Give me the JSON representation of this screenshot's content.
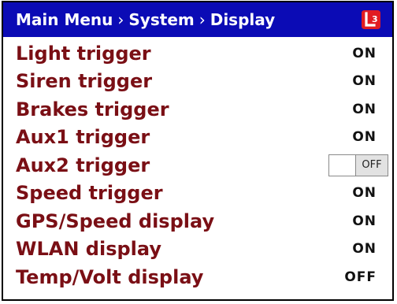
{
  "header": {
    "crumbs": [
      "Main Menu",
      "System",
      "Display"
    ],
    "separator": "›",
    "logo_icon": "l3-logo-icon",
    "background_color": "#0b0bb5"
  },
  "label_color": "#7a0f15",
  "rows": [
    {
      "label": "Light trigger",
      "value": "ON"
    },
    {
      "label": "Siren trigger",
      "value": "ON"
    },
    {
      "label": "Brakes trigger",
      "value": "ON"
    },
    {
      "label": "Aux1 trigger",
      "value": "ON"
    },
    {
      "label": "Aux2 trigger",
      "value": "OFF",
      "control": "toggle-switch"
    },
    {
      "label": "Speed trigger",
      "value": "ON"
    },
    {
      "label": "GPS/Speed display",
      "value": "ON"
    },
    {
      "label": "WLAN display",
      "value": "ON"
    },
    {
      "label": "Temp/Volt display",
      "value": "OFF"
    }
  ]
}
